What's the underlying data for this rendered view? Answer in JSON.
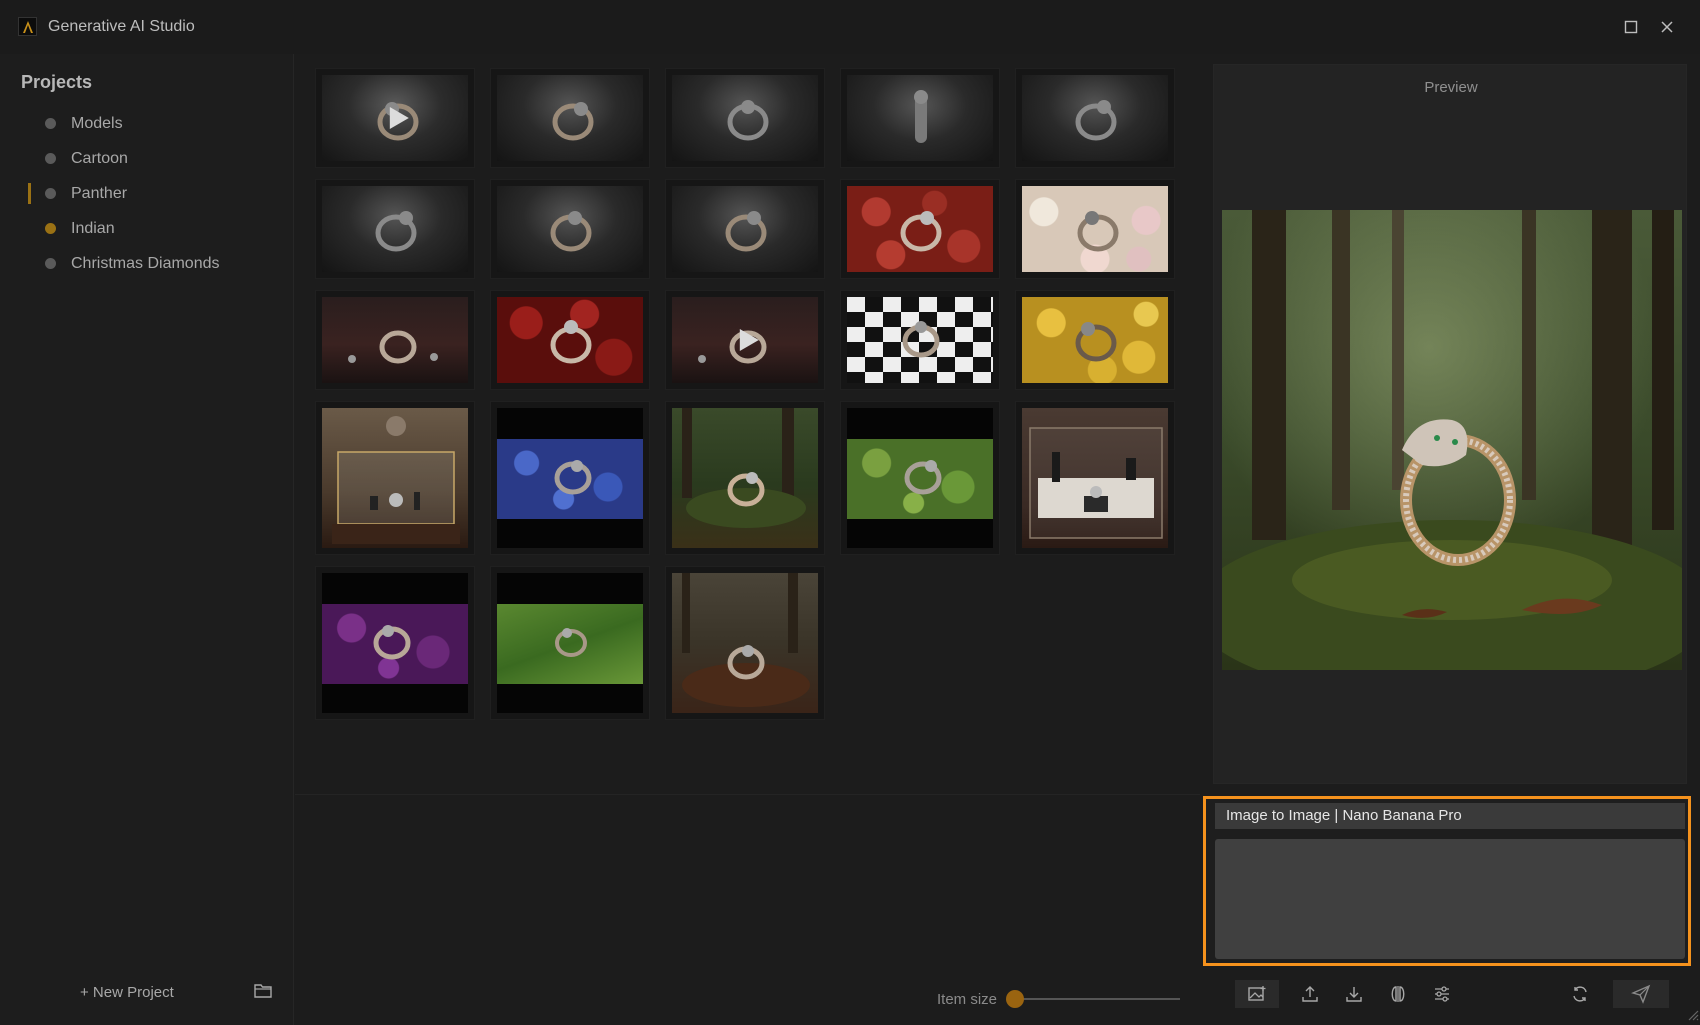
{
  "window": {
    "title": "Generative AI Studio",
    "logo_icon": "app-logo-icon",
    "maximize_icon": "maximize-icon",
    "close_icon": "close-icon"
  },
  "sidebar": {
    "heading": "Projects",
    "projects": [
      {
        "label": "Models",
        "dot_color": "#5a5a5a"
      },
      {
        "label": "Cartoon",
        "dot_color": "#5a5a5a"
      },
      {
        "label": "Panther",
        "dot_color": "#5a5a5a",
        "selected": true
      },
      {
        "label": "Indian",
        "dot_color": "#9a7114"
      },
      {
        "label": "Christmas Diamonds",
        "dot_color": "#5a5a5a"
      }
    ],
    "new_project_label": "+ New Project",
    "folder_icon": "folder-icon"
  },
  "gallery": {
    "thumbnails": [
      {
        "scene": "dark spotlight ring",
        "video": true
      },
      {
        "scene": "dark spotlight ring",
        "video": false
      },
      {
        "scene": "dark spotlight ring",
        "video": false
      },
      {
        "scene": "dark spotlight ring standing",
        "video": false
      },
      {
        "scene": "dark spotlight ring",
        "video": false
      },
      {
        "scene": "dark spotlight ring",
        "video": false
      },
      {
        "scene": "dark spotlight ring",
        "video": false
      },
      {
        "scene": "dark spotlight ring",
        "video": false
      },
      {
        "scene": "red roses",
        "video": false
      },
      {
        "scene": "white and pink roses",
        "video": false
      },
      {
        "scene": "dark table reflection",
        "video": false
      },
      {
        "scene": "red roses",
        "video": false
      },
      {
        "scene": "dark table reflection",
        "video": true
      },
      {
        "scene": "checkerboard floor",
        "video": false
      },
      {
        "scene": "yellow roses",
        "video": false
      },
      {
        "scene": "boutique glass display",
        "video": false
      },
      {
        "scene": "blue hydrangeas",
        "video": false
      },
      {
        "scene": "forest moss",
        "video": false
      },
      {
        "scene": "green succulents",
        "video": false
      },
      {
        "scene": "jewelry store display",
        "video": false
      },
      {
        "scene": "purple roses",
        "video": false
      },
      {
        "scene": "green leaves",
        "video": false
      },
      {
        "scene": "forest floor autumn",
        "video": false
      }
    ],
    "item_size_label": "Item size",
    "item_size_value": 0,
    "accent_color": "#9a6410"
  },
  "preview": {
    "label": "Preview",
    "scene": "panther bangle on moss in forest"
  },
  "prompt": {
    "mode_label": "Image to Image | Nano Banana Pro",
    "placeholder": "",
    "highlight_color": "#f5921d"
  },
  "toolbar": {
    "icons": [
      "add-image-icon",
      "upload-icon",
      "download-icon",
      "compare-icon",
      "settings-sliders-icon",
      "refresh-icon",
      "send-icon"
    ]
  }
}
